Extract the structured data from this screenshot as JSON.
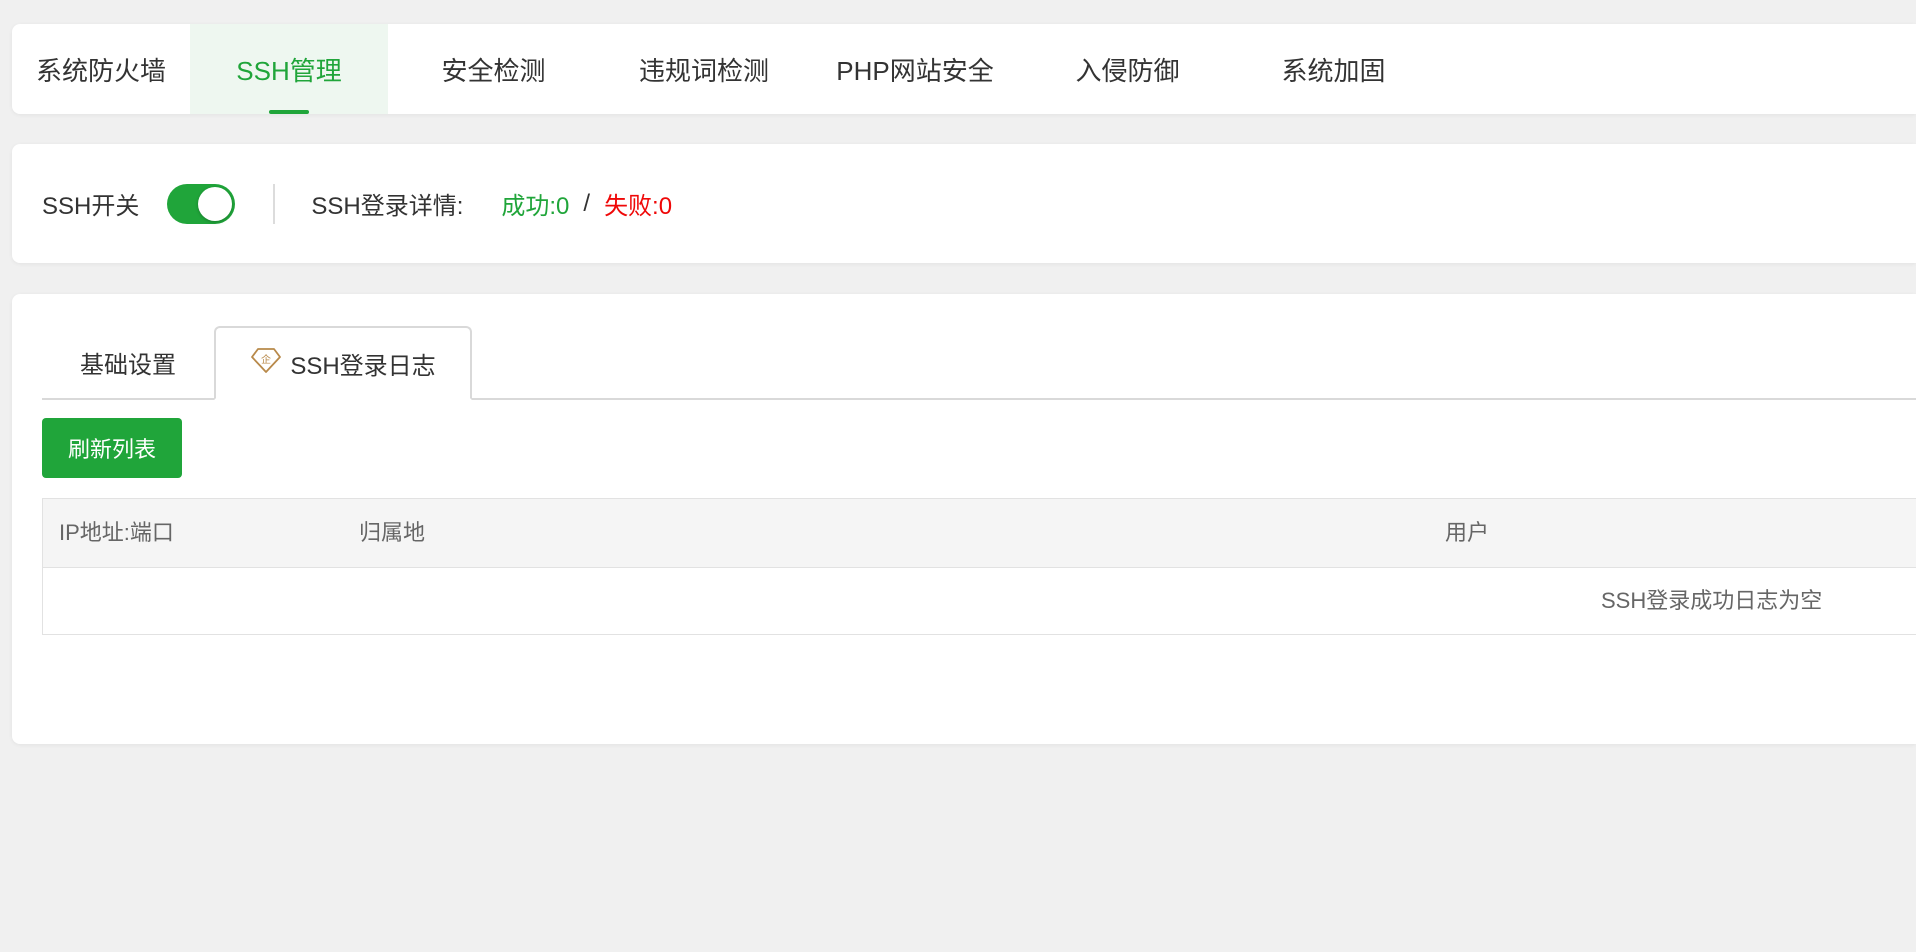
{
  "topnav": {
    "tabs": [
      {
        "label": "系统防火墙"
      },
      {
        "label": "SSH管理"
      },
      {
        "label": "安全检测"
      },
      {
        "label": "违规词检测"
      },
      {
        "label": "PHP网站安全"
      },
      {
        "label": "入侵防御"
      },
      {
        "label": "系统加固"
      }
    ],
    "active_index": 1
  },
  "status": {
    "switch_label": "SSH开关",
    "switch_on": true,
    "detail_label": "SSH登录详情:",
    "success_text": "成功:0",
    "separator": "/",
    "fail_text": "失败:0"
  },
  "subtabs": {
    "basic": "基础设置",
    "log": "SSH登录日志",
    "log_icon": "enterprise-gem-icon"
  },
  "toolbar": {
    "refresh_label": "刷新列表"
  },
  "table": {
    "columns": [
      "IP地址:端口",
      "归属地",
      "用户"
    ],
    "empty_text": "SSH登录成功日志为空"
  },
  "colors": {
    "accent": "#20a53a",
    "fail": "#ef0808",
    "gem": "#b8894a"
  }
}
